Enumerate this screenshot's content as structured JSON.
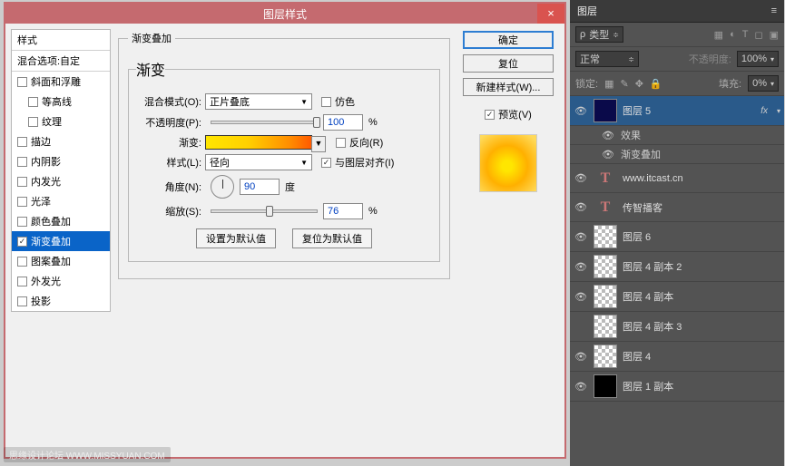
{
  "dialog": {
    "title": "图层样式",
    "close": "×",
    "styles_header": "样式",
    "blend_header": "混合选项:自定",
    "styles": [
      {
        "label": "斜面和浮雕",
        "indent": false,
        "checked": false
      },
      {
        "label": "等高线",
        "indent": true,
        "checked": false
      },
      {
        "label": "纹理",
        "indent": true,
        "checked": false
      },
      {
        "label": "描边",
        "indent": false,
        "checked": false
      },
      {
        "label": "内阴影",
        "indent": false,
        "checked": false
      },
      {
        "label": "内发光",
        "indent": false,
        "checked": false
      },
      {
        "label": "光泽",
        "indent": false,
        "checked": false
      },
      {
        "label": "颜色叠加",
        "indent": false,
        "checked": false
      },
      {
        "label": "渐变叠加",
        "indent": false,
        "checked": true,
        "selected": true
      },
      {
        "label": "图案叠加",
        "indent": false,
        "checked": false
      },
      {
        "label": "外发光",
        "indent": false,
        "checked": false
      },
      {
        "label": "投影",
        "indent": false,
        "checked": false
      }
    ],
    "group_title": "渐变叠加",
    "gradient_title": "渐变",
    "blend_mode_label": "混合模式(O):",
    "blend_mode_value": "正片叠底",
    "dither_label": "仿色",
    "opacity_label": "不透明度(P):",
    "opacity_value": "100",
    "percent": "%",
    "gradient_label": "渐变:",
    "reverse_label": "反向(R)",
    "style_label": "样式(L):",
    "style_value": "径向",
    "align_label": "与图层对齐(I)",
    "angle_label": "角度(N):",
    "angle_value": "90",
    "degree": "度",
    "scale_label": "缩放(S):",
    "scale_value": "76",
    "set_default": "设置为默认值",
    "reset_default": "复位为默认值",
    "ok": "确定",
    "cancel": "复位",
    "new_style": "新建样式(W)...",
    "preview_label": "预览(V)"
  },
  "panel": {
    "title": "图层",
    "menu_glyph": "≡",
    "kind_label": "类型",
    "blend_value": "正常",
    "opacity_label": "不透明度:",
    "opacity_value": "100%",
    "lock_label": "锁定:",
    "fill_label": "填充:",
    "fill_value": "0%",
    "effects_label": "效果",
    "grad_overlay_label": "渐变叠加",
    "layers": [
      {
        "name": "图层 5",
        "thumb": "navy",
        "selected": true,
        "fx": true,
        "text": false
      },
      {
        "name": "www.itcast.cn",
        "thumb": "T",
        "text": true
      },
      {
        "name": "传智播客",
        "thumb": "T",
        "text": true
      },
      {
        "name": "图层 6",
        "thumb": "checker"
      },
      {
        "name": "图层 4 副本 2",
        "thumb": "checker"
      },
      {
        "name": "图层 4 副本",
        "thumb": "checker"
      },
      {
        "name": "图层 4 副本 3",
        "thumb": "checker"
      },
      {
        "name": "图层 4",
        "thumb": "checker"
      },
      {
        "name": "图层 1 副本",
        "thumb": "black"
      }
    ]
  },
  "watermark": "思缘设计论坛   WWW.MISSYUAN.COM"
}
